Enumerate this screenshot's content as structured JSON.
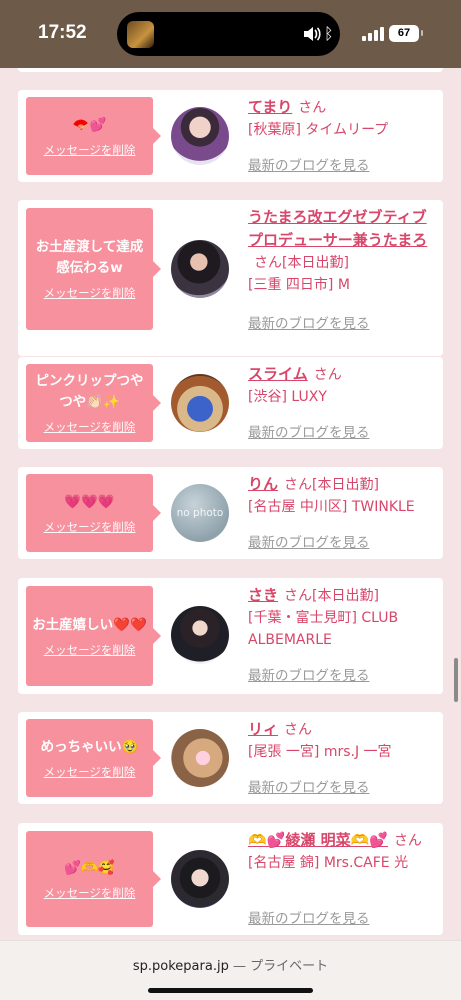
{
  "status": {
    "time": "17:52",
    "battery": "67"
  },
  "cards": [
    {
      "message": "🪭💕",
      "delete_label": "メッセージを削除",
      "name": "てまり",
      "suffix": "さん",
      "shop": "[秋葉原] タイムリープ",
      "blog_link": "最新のブログを見る"
    },
    {
      "message": "お土産渡して達成感伝わるw",
      "delete_label": "メッセージを削除",
      "name": "うたまろ改エグゼブティブプロデューサー兼うたまろ",
      "suffix": "さん[本日出勤]",
      "shop": "[三重 四日市] M",
      "blog_link": "最新のブログを見る"
    },
    {
      "message": "ピンクリップつやつや👏🏻✨",
      "delete_label": "メッセージを削除",
      "name": "スライム",
      "suffix": "さん",
      "shop": "[渋谷] LUXY",
      "blog_link": "最新のブログを見る"
    },
    {
      "message": "💗💗💗",
      "delete_label": "メッセージを削除",
      "name": "りん",
      "suffix": "さん[本日出勤]",
      "shop": "[名古屋 中川区] TWINKLE",
      "blog_link": "最新のブログを見る",
      "avatar_text": "no photo"
    },
    {
      "message": "お土産嬉しい❤️❤️",
      "delete_label": "メッセージを削除",
      "name": "さき",
      "suffix": "さん[本日出勤]",
      "shop": "[千葉・富士見町] CLUB ALBEMARLE",
      "blog_link": "最新のブログを見る"
    },
    {
      "message": "めっちゃいい🥹",
      "delete_label": "メッセージを削除",
      "name": "リィ",
      "suffix": "さん",
      "shop": "[尾張 一宮] mrs.J 一宮",
      "blog_link": "最新のブログを見る"
    },
    {
      "message": "💕🫶🥰",
      "delete_label": "メッセージを削除",
      "name": "🫶💕綾瀬 明菜🫶💕",
      "suffix": "さん",
      "shop": "[名古屋 錦] Mrs.CAFE 光",
      "blog_link": "最新のブログを見る"
    }
  ],
  "browser": {
    "domain": "sp.pokepara.jp",
    "privacy": "— プライベート"
  },
  "colors": {
    "accent": "#d8466a",
    "bubble": "#f7919e",
    "background": "#f5e4e6"
  }
}
